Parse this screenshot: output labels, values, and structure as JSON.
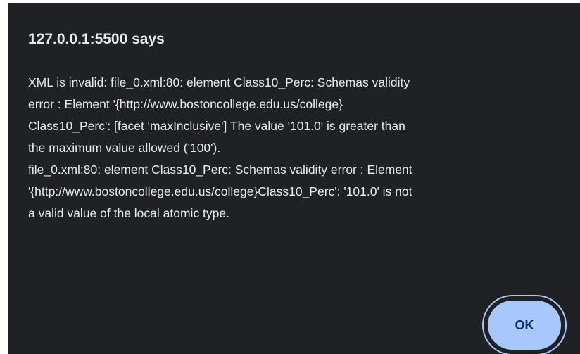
{
  "dialog": {
    "title": "127.0.0.1:5500 says",
    "message_lines": [
      "XML is invalid: file_0.xml:80: element Class10_Perc: Schemas validity",
      "error : Element '{http://www.bostoncollege.edu.us/college}",
      "Class10_Perc': [facet 'maxInclusive'] The value '101.0' is greater than",
      "the maximum value allowed ('100').",
      "file_0.xml:80: element Class10_Perc: Schemas validity error : Element",
      "'{http://www.bostoncollege.edu.us/college}Class10_Perc': '101.0' is not",
      "a valid value of the local atomic type."
    ],
    "ok_label": "OK"
  },
  "colors": {
    "dialog_background": "#202124",
    "text": "#e8eaed",
    "button_fill": "#a8c7fa",
    "button_text": "#062e6f"
  }
}
